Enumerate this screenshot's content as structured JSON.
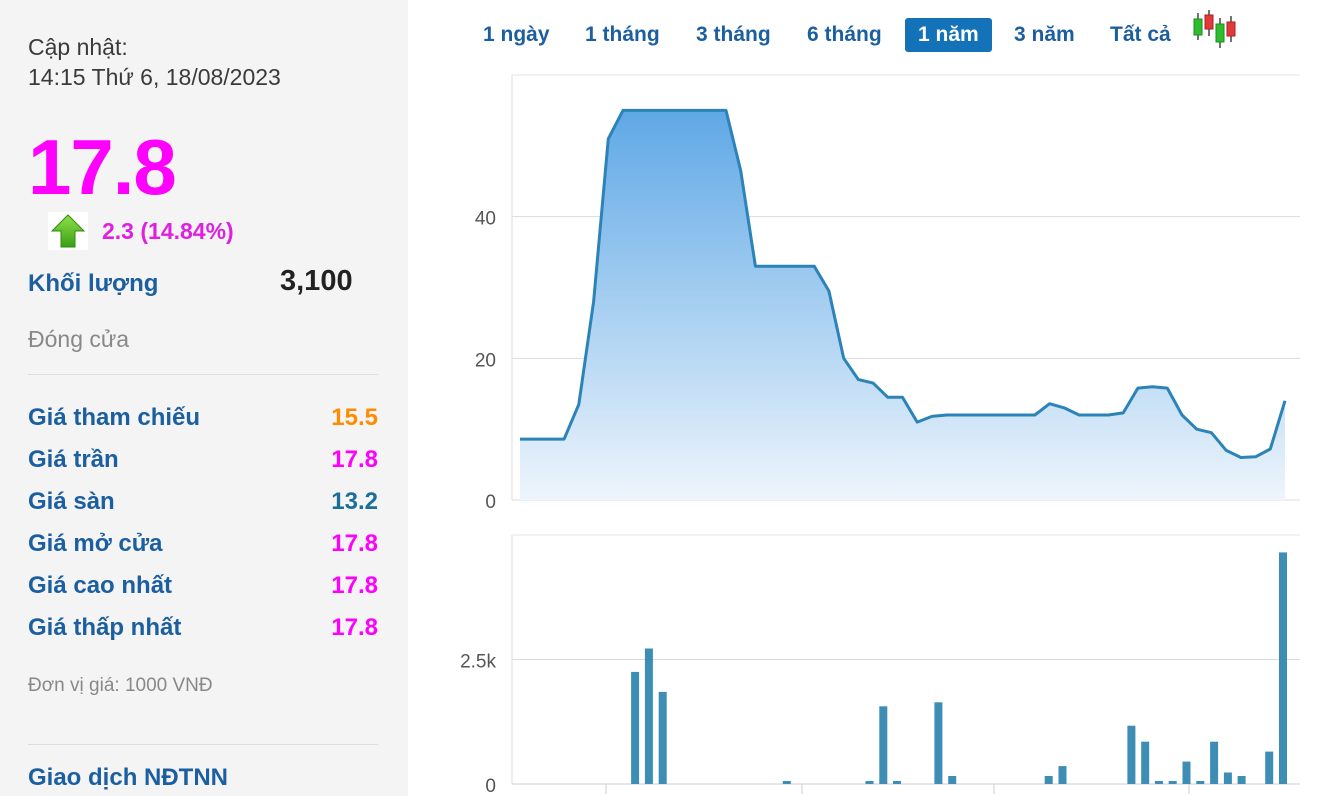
{
  "sidebar": {
    "updated_label": "Cập nhật:",
    "updated_time": "14:15 Thứ 6, 18/08/2023",
    "price": "17.8",
    "change": "2.3 (14.84%)",
    "volume_label": "Khối lượng",
    "volume_value": "3,100",
    "status": "Đóng cửa",
    "rows": [
      {
        "label": "Giá tham chiếu",
        "value": "15.5",
        "color": "#ff8c00"
      },
      {
        "label": "Giá trần",
        "value": "17.8",
        "color": "#ff00ff"
      },
      {
        "label": "Giá sàn",
        "value": "13.2",
        "color": "#1a6e9a"
      },
      {
        "label": "Giá mở cửa",
        "value": "17.8",
        "color": "#ff00ff"
      },
      {
        "label": "Giá cao nhất",
        "value": "17.8",
        "color": "#ff00ff"
      },
      {
        "label": "Giá thấp nhất",
        "value": "17.8",
        "color": "#ff00ff"
      }
    ],
    "unit_note": "Đơn vị giá: 1000 VNĐ",
    "foreign_trade": "Giao dịch NĐTNN"
  },
  "tabs": [
    {
      "label": "1 ngày",
      "active": false
    },
    {
      "label": "1 tháng",
      "active": false
    },
    {
      "label": "3 tháng",
      "active": false
    },
    {
      "label": "6 tháng",
      "active": false
    },
    {
      "label": "1 năm",
      "active": true
    },
    {
      "label": "3 năm",
      "active": false
    },
    {
      "label": "Tất cả",
      "active": false
    }
  ],
  "icons": {
    "change_direction": "up-arrow-icon",
    "chart_style": "candlestick-icon"
  },
  "colors": {
    "accent": "#1473b8",
    "price": "#ff00ff",
    "line": "#2b83b8",
    "volume_bar": "#3d8db5"
  },
  "chart_data": [
    {
      "type": "area",
      "ylim": [
        0,
        60
      ],
      "yticks": [
        "0",
        "20",
        "40"
      ],
      "grid": true,
      "values": [
        8.6,
        8.6,
        8.6,
        8.6,
        13.5,
        28,
        51,
        55,
        55,
        55,
        55,
        55,
        55,
        55,
        55,
        46.5,
        33,
        33,
        33,
        33,
        33,
        29.5,
        20,
        17,
        16.5,
        14.5,
        14.5,
        11,
        11.8,
        12,
        12,
        12,
        12,
        12,
        12,
        12,
        13.6,
        13,
        12,
        12,
        12,
        12.3,
        15.8,
        16,
        15.8,
        12,
        10,
        9.5,
        7,
        6,
        6.1,
        7.2,
        14
      ]
    },
    {
      "type": "bar",
      "ylim": [
        0,
        5000
      ],
      "yticks": [
        "0",
        "2.5k"
      ],
      "grid": true,
      "values": [
        0,
        0,
        0,
        0,
        2250,
        2720,
        1850,
        0,
        0,
        0,
        0,
        0,
        0,
        0,
        0,
        60,
        0,
        0,
        0,
        0,
        0,
        60,
        1560,
        60,
        0,
        0,
        1640,
        160,
        0,
        0,
        0,
        0,
        0,
        0,
        160,
        360,
        0,
        0,
        0,
        0,
        1170,
        850,
        60,
        60,
        450,
        60,
        850,
        230,
        160,
        0,
        650,
        4650
      ]
    }
  ]
}
